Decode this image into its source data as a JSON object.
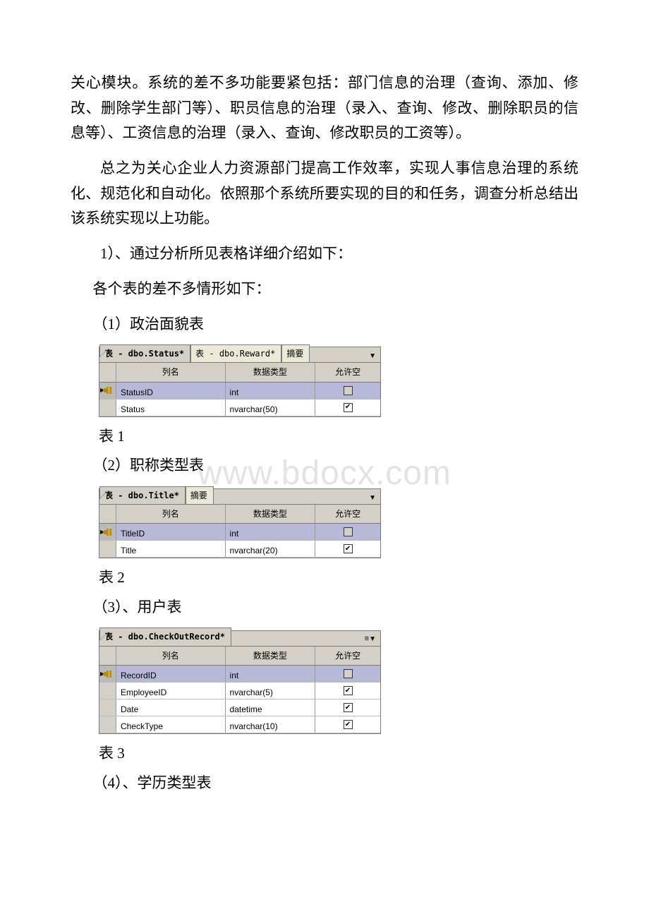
{
  "watermark": "www.bdocx.com",
  "paragraphs": {
    "p1": "关心模块。系统的差不多功能要紧包括：部门信息的治理（查询、添加、修改、删除学生部门等）、职员信息的治理（录入、查询、修改、删除职员的信息等）、工资信息的治理（录入、查询、修改职员的工资等）。",
    "p2": "总之为关心企业人力资源部门提高工作效率，实现人事信息治理的系统化、规范化和自动化。依照那个系统所要实现的目的和任务，调查分析总结出该系统实现以上功能。",
    "p3": "1）、通过分析所见表格详细介绍如下：",
    "p4": "各个表的差不多情形如下：",
    "p5": "（1）政治面貌表",
    "label1": "表 1",
    "p6": "（2）职称类型表",
    "label2": "表 2",
    "p7": "（3）、用户表",
    "label3": "表 3",
    "p8": "（4）、学历类型表"
  },
  "headers": {
    "col": "列名",
    "type": "数据类型",
    "null": "允许空"
  },
  "tabs": {
    "status": "表 - dbo.Status*",
    "reward": "表 - dbo.Reward*",
    "summary": "摘要",
    "title": "表 - dbo.Title*",
    "checkout": "表 - dbo.CheckOutRecord*"
  },
  "table1": {
    "rows": [
      {
        "name": "StatusID",
        "type": "int",
        "null": false,
        "pk": true
      },
      {
        "name": "Status",
        "type": "nvarchar(50)",
        "null": true,
        "pk": false
      }
    ]
  },
  "table2": {
    "rows": [
      {
        "name": "TitleID",
        "type": "int",
        "null": false,
        "pk": true
      },
      {
        "name": "Title",
        "type": "nvarchar(20)",
        "null": true,
        "pk": false
      }
    ]
  },
  "table3": {
    "rows": [
      {
        "name": "RecordID",
        "type": "int",
        "null": false,
        "pk": true
      },
      {
        "name": "EmployeeID",
        "type": "nvarchar(5)",
        "null": true,
        "pk": false
      },
      {
        "name": "Date",
        "type": "datetime",
        "null": true,
        "pk": false
      },
      {
        "name": "CheckType",
        "type": "nvarchar(10)",
        "null": true,
        "pk": false
      }
    ]
  }
}
